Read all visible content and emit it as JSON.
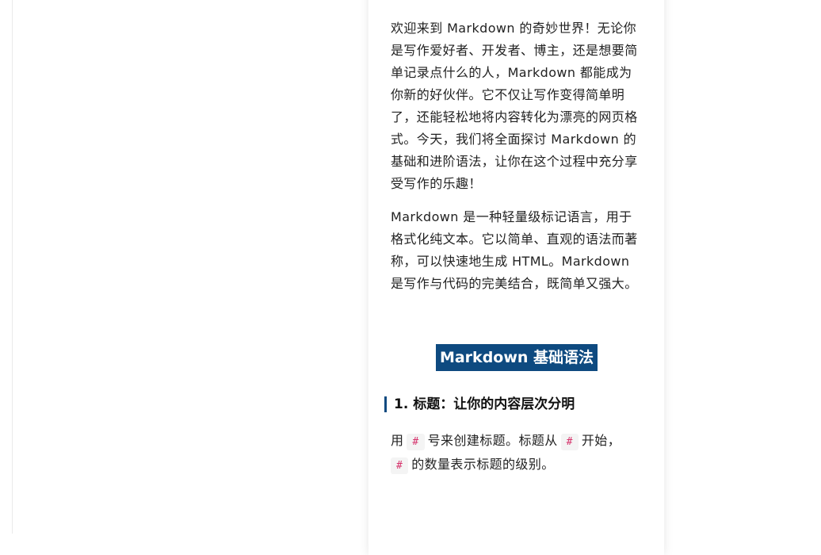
{
  "article": {
    "intro": "欢迎来到 Markdown 的奇妙世界！无论你是写作爱好者、开发者、博主，还是想要简单记录点什么的人，Markdown 都能成为你新的好伙伴。它不仅让写作变得简单明了，还能轻松地将内容转化为漂亮的网页格式。今天，我们将全面探讨 Markdown 的基础和进阶语法，让你在这个过程中充分享受写作的乐趣！",
    "definition": "Markdown 是一种轻量级标记语言，用于格式化纯文本。它以简单、直观的语法而著称，可以快速地生成 HTML。Markdown 是写作与代码的完美结合，既简单又强大。",
    "section_title": "Markdown 基础语法",
    "subsection_title": "1. 标题：让你的内容层次分明",
    "heading_para": {
      "part1": "用",
      "code1": "#",
      "part2": "号来创建标题。标题从",
      "code2": "#",
      "part3": "开始，",
      "code3": "#",
      "part4": "的数量表示标题的级别。"
    }
  },
  "colors": {
    "accent": "#0e4a80",
    "code_text": "#d6336c",
    "code_bg": "#f4f4f4"
  }
}
